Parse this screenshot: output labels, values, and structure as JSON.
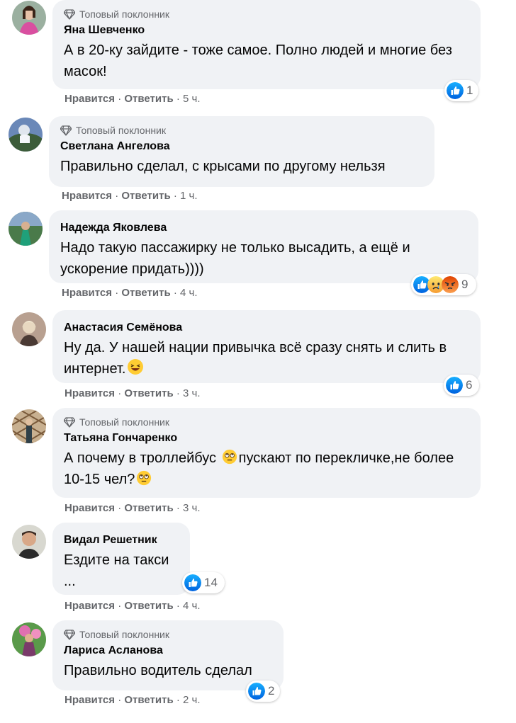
{
  "common": {
    "like_label": "Нравится",
    "separator": " · ",
    "reply_label": "Ответить",
    "top_fan_badge": "Топовый поклонник",
    "colors": {
      "bubble": "#f0f2f5",
      "meta": "#65676b",
      "like_blue": "#1877f2"
    }
  },
  "comments": [
    {
      "author": "Яна Шевченко",
      "top_fan": true,
      "text": "А в 20-ку зайдите - тоже самое. Полно людей и многие без масок!",
      "time": "5 ч.",
      "reaction_count": "1",
      "reaction_icons": [
        "like-icon"
      ]
    },
    {
      "author": "Светлана Ангелова",
      "top_fan": true,
      "text": "Правильно сделал, с крысами по другому нельзя",
      "time": "1 ч.",
      "reaction_count": "",
      "reaction_icons": []
    },
    {
      "author": "Надежда Яковлева",
      "top_fan": false,
      "text": "Надо такую пассажирку не только высадить, а ещё и ускорение придать))))",
      "time": "4 ч.",
      "reaction_count": "9",
      "reaction_icons": [
        "like-icon",
        "sad-icon",
        "angry-icon"
      ]
    },
    {
      "author": "Анастасия Семёнова",
      "top_fan": false,
      "text": "Ну да. У нашей нации привычка всё сразу снять и слить в интернет.",
      "time": "3 ч.",
      "reaction_count": "6",
      "reaction_icons": [
        "like-icon"
      ]
    },
    {
      "author": "Татьяна Гончаренко",
      "top_fan": true,
      "text_part1": "А почему в троллейбус ",
      "text_part2": "пускают по перекличке,не более 10-15 чел?",
      "time": "3 ч.",
      "reaction_count": "",
      "reaction_icons": []
    },
    {
      "author": "Видал Решетник",
      "top_fan": false,
      "text": "Ездите на такси\n...",
      "time": "4 ч.",
      "reaction_count": "14",
      "reaction_icons": [
        "like-icon"
      ]
    },
    {
      "author": "Лариса Асланова",
      "top_fan": true,
      "text": "Правильно водитель сделал",
      "time": "2 ч.",
      "reaction_count": "2",
      "reaction_icons": [
        "like-icon"
      ]
    }
  ]
}
